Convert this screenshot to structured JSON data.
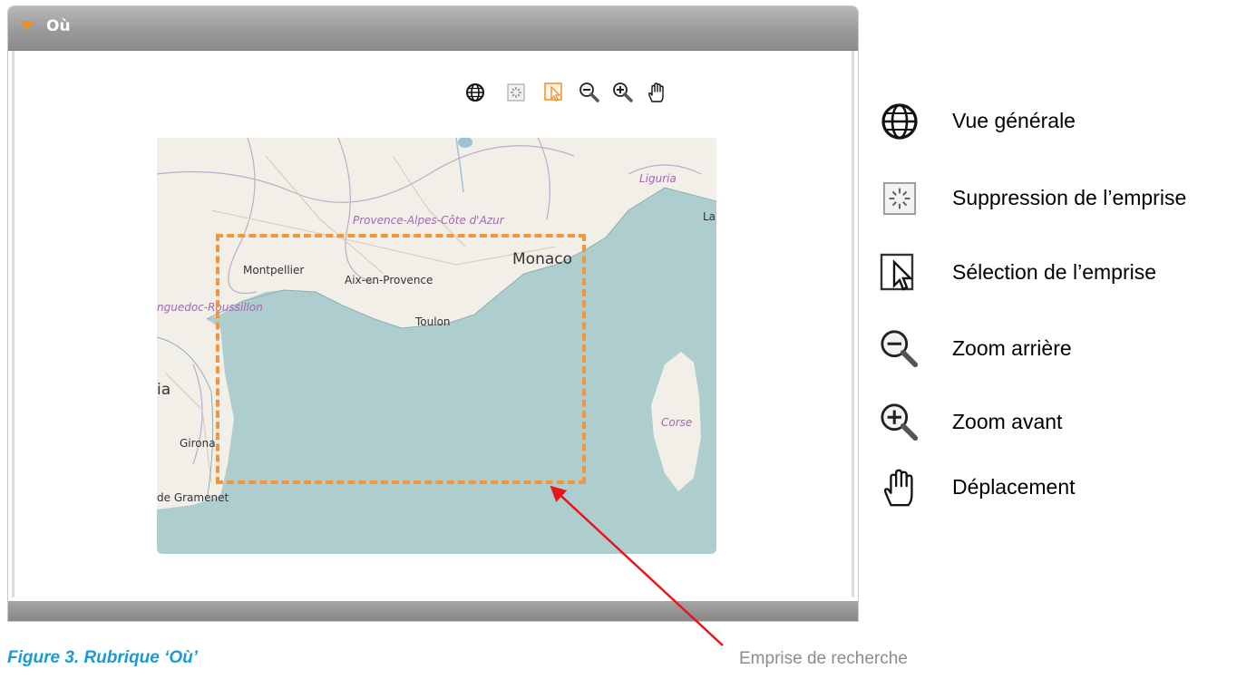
{
  "panel": {
    "title": "Où",
    "toolbar": [
      {
        "icon": "globe-icon",
        "tooltip": "Vue générale"
      },
      {
        "icon": "remove-extent-icon",
        "tooltip": "Suppression de l’emprise"
      },
      {
        "icon": "select-extent-icon",
        "tooltip": "Sélection de l’emprise",
        "active": true
      },
      {
        "icon": "zoom-out-icon",
        "tooltip": "Zoom arrière"
      },
      {
        "icon": "zoom-in-icon",
        "tooltip": "Zoom avant"
      },
      {
        "icon": "pan-hand-icon",
        "tooltip": "Déplacement"
      }
    ]
  },
  "map": {
    "labels": {
      "liguria": "Liguria",
      "region_paca": "Provence-Alpes-Côte d'Azur",
      "la": "La",
      "monaco": "Monaco",
      "montpellier": "Montpellier",
      "aix": "Aix-en-Provence",
      "languedoc": "nguedoc-Roussillon",
      "toulon": "Toulon",
      "ia": "ia",
      "corse": "Corse",
      "girona": "Girona",
      "gramenet": "de Gramenet"
    },
    "colors": {
      "sea": "#aecdcf",
      "land": "#f2efe9",
      "extent_border": "#f3953b",
      "region_text": "#a368b0"
    }
  },
  "legend": [
    {
      "icon": "globe-icon",
      "label": "Vue générale"
    },
    {
      "icon": "remove-extent-icon",
      "label": "Suppression de l’emprise"
    },
    {
      "icon": "select-extent-icon",
      "label": "Sélection de l’emprise"
    },
    {
      "icon": "zoom-out-icon",
      "label": "Zoom arrière"
    },
    {
      "icon": "zoom-in-icon",
      "label": "Zoom avant"
    },
    {
      "icon": "pan-hand-icon",
      "label": "Déplacement"
    }
  ],
  "caption": "Figure 3. Rubrique ‘Où’",
  "annotation": "Emprise de recherche",
  "colors": {
    "caption": "#1a9bd7",
    "annotation": "#8c8c8c",
    "arrow": "#e8161b",
    "header_arrow": "#f28c28"
  }
}
